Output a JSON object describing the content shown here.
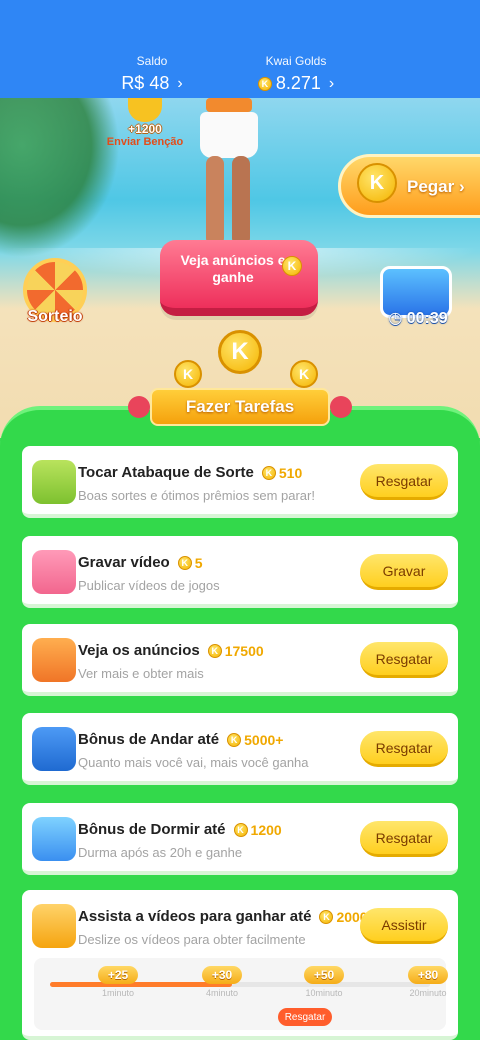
{
  "header": {
    "balance_label": "Saldo",
    "balance_value": "R$ 48",
    "golds_label": "Kwai Golds",
    "golds_value": "8.271"
  },
  "scene": {
    "bless_amount": "+1200",
    "bless_label": "Enviar Benção",
    "pegar_label": "Pegar",
    "sorteio_label": "Sorteio",
    "ads_button_label": "Veja anúncios e ganhe",
    "timer": "00:39"
  },
  "banner": {
    "title": "Fazer Tarefas"
  },
  "tasks": [
    {
      "title": "Tocar Atabaque de Sorte",
      "reward": "510",
      "subtitle": "Boas sortes e ótimos prêmios sem parar!",
      "button": "Resgatar",
      "icon": "drum-icon"
    },
    {
      "title": "Gravar vídeo",
      "reward": "5",
      "subtitle": "Publicar vídeos de jogos",
      "button": "Gravar",
      "icon": "camera-record-icon"
    },
    {
      "title": "Veja os anúncios",
      "reward": "17500",
      "subtitle": "Ver mais e obter mais",
      "button": "Resgatar",
      "icon": "tv-icon"
    },
    {
      "title": "Bônus de Andar até",
      "reward": "5000+",
      "subtitle": "Quanto mais você vai, mais você ganha",
      "button": "Resgatar",
      "icon": "walking-icon"
    },
    {
      "title": "Bônus de Dormir até",
      "reward": "1200",
      "subtitle": "Durma após as 20h e ganhe",
      "button": "Resgatar",
      "icon": "sleep-icon"
    },
    {
      "title": "Assista a vídeos para ganhar até",
      "reward": "2000",
      "subtitle": "Deslize os vídeos para obter facilmente",
      "button": "Assistir",
      "icon": "video-camera-icon"
    }
  ],
  "video_progress": {
    "steps": [
      {
        "amount": "+25",
        "caption": "1minuto"
      },
      {
        "amount": "+30",
        "caption": "4minuto"
      },
      {
        "amount": "+50",
        "caption": "10minuto"
      },
      {
        "amount": "+80",
        "caption": "20minuto"
      }
    ],
    "progress_fraction": 0.48,
    "claim_label": "Resgatar"
  },
  "colors": {
    "header_blue": "#2f86f5",
    "panel_green": "#33d94b",
    "button_yellow": "#ffd83a",
    "coin_gold": "#f5b400",
    "claim_orange": "#ff5d2c"
  }
}
